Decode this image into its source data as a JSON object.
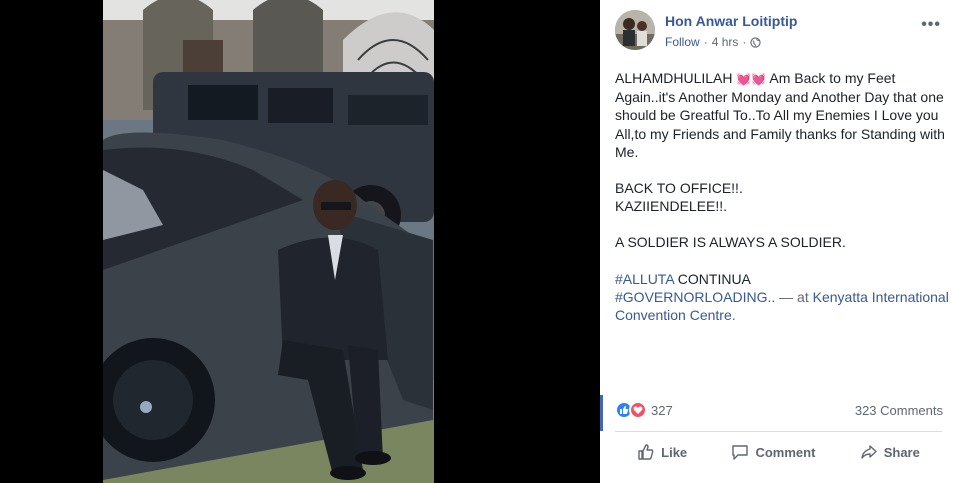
{
  "post": {
    "author": "Hon Anwar Loitiptip",
    "follow_label": "Follow",
    "separator": "·",
    "time": "4 hrs",
    "more_label": "•••",
    "text": {
      "line1_a": "ALHAMDHULILAH",
      "hearts": "💓💓",
      "line1_b": "Am Back to my Feet Again..it's Another Monday and Another Day that one should be Greatful To..To All my Enemies I Love you All,to my Friends and Family thanks for Standing with Me.",
      "para2": "BACK TO OFFICE!!.\nKAZIIENDELEE!!.",
      "para3": "A SOLDIER IS ALWAYS A SOLDIER.",
      "hashtag1": "#ALLUTA",
      "hashtag1_rest": " CONTINUA",
      "hashtag2": "#GOVERNORLOADING..",
      "at_text": " — at ",
      "place": "Kenyatta International Convention Centre",
      "end": "."
    }
  },
  "stats": {
    "reaction_count": "327",
    "comments": "323 Comments"
  },
  "actions": {
    "like": "Like",
    "comment": "Comment",
    "share": "Share"
  },
  "colors": {
    "link": "#385898",
    "like_blue": "#2e81f4",
    "love_red": "#f25268"
  },
  "icons": [
    "more-options-icon",
    "globe-icon",
    "like-reaction-icon",
    "love-reaction-icon",
    "like-icon",
    "comment-icon",
    "share-icon"
  ]
}
